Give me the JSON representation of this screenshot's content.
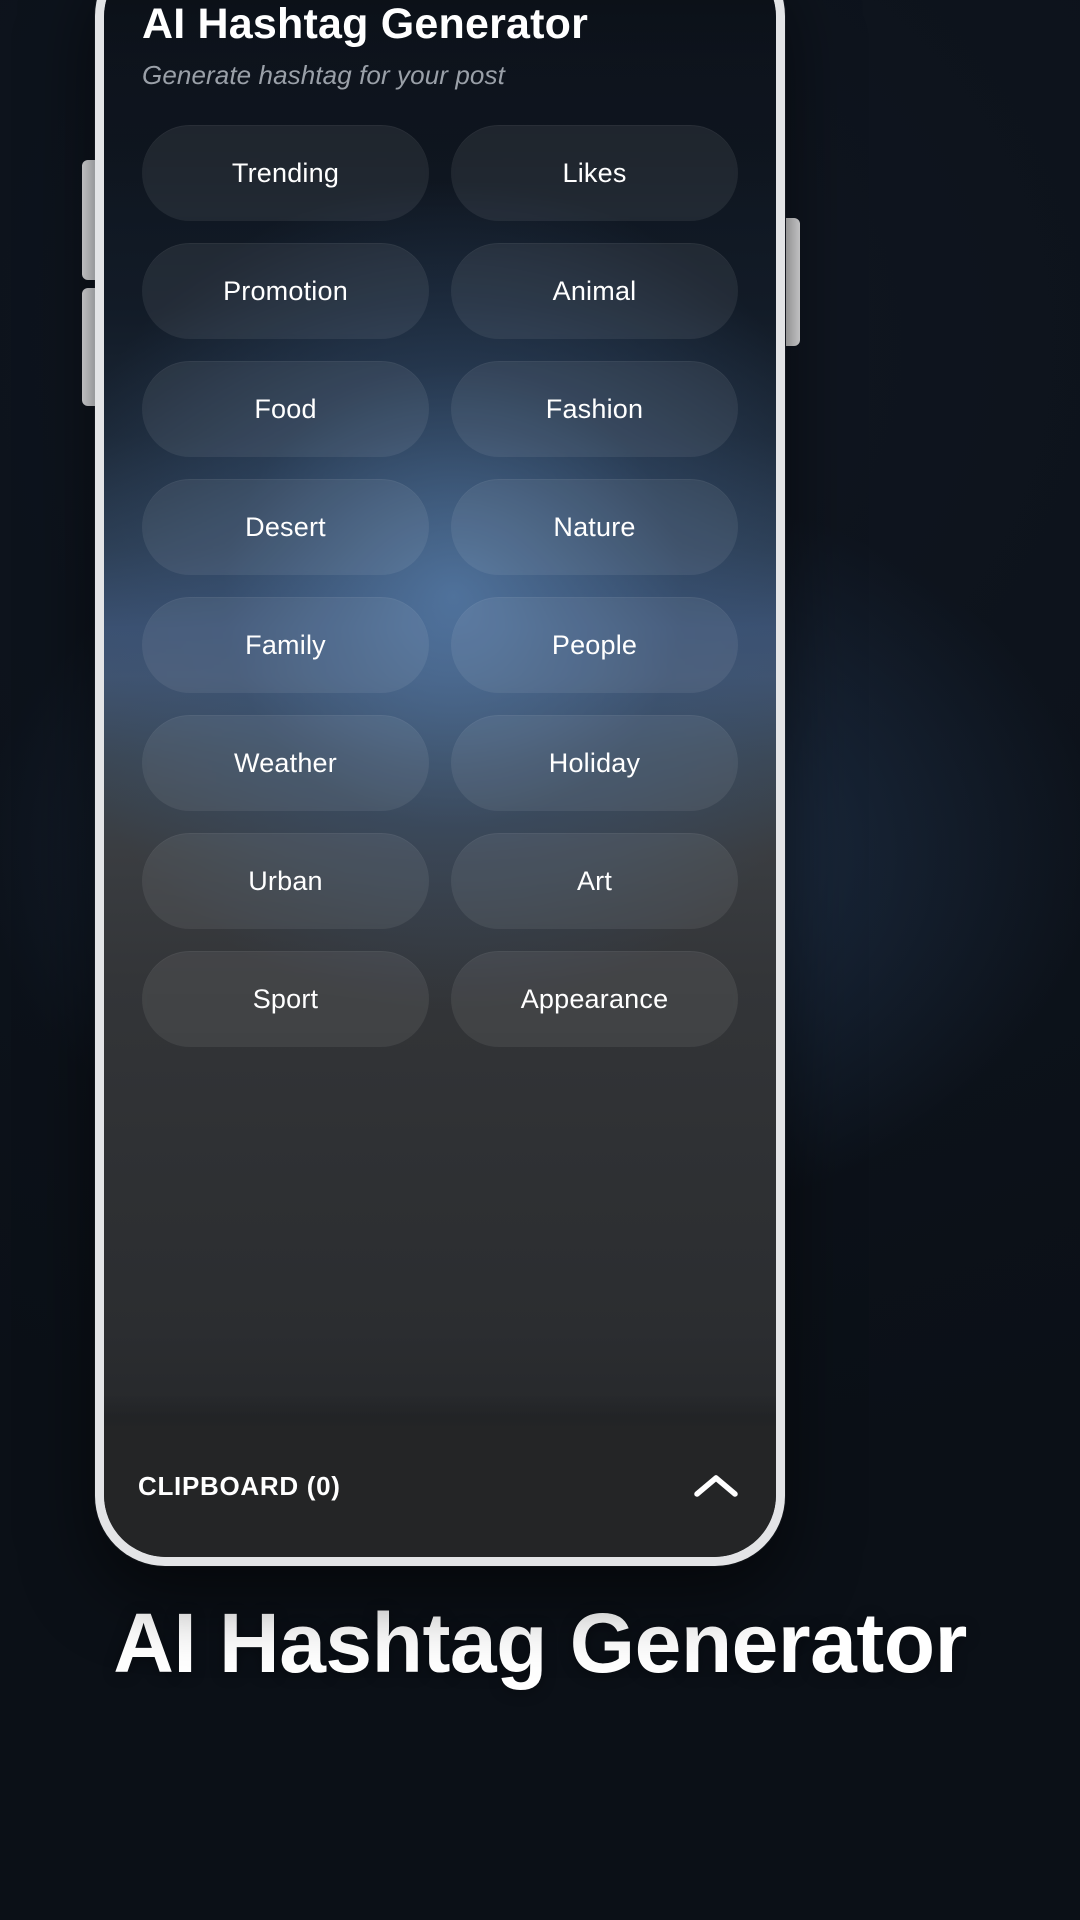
{
  "promo": {
    "caption": "AI Hashtag Generator",
    "background_top_color": "#0c1118",
    "background_mid_color": "#33414f",
    "background_bottom_color": "#2b2e32"
  },
  "phone": {
    "frame_color": "#e3e4e6",
    "buttons": [
      {
        "name": "volume-up",
        "label": "Volume Up"
      },
      {
        "name": "volume-down",
        "label": "Volume Down"
      },
      {
        "name": "power",
        "label": "Power"
      }
    ]
  },
  "app": {
    "title": "AI Hashtag Generator",
    "subtitle": "Generate hashtag for your post",
    "title_color": "#ffffff",
    "subtitle_color": "#9aa0a8",
    "categories": [
      {
        "label": "Trending"
      },
      {
        "label": "Likes"
      },
      {
        "label": "Promotion"
      },
      {
        "label": "Animal"
      },
      {
        "label": "Food"
      },
      {
        "label": "Fashion"
      },
      {
        "label": "Desert"
      },
      {
        "label": "Nature"
      },
      {
        "label": "Family"
      },
      {
        "label": "People"
      },
      {
        "label": "Weather"
      },
      {
        "label": "Holiday"
      },
      {
        "label": "Urban"
      },
      {
        "label": "Art"
      },
      {
        "label": "Sport"
      },
      {
        "label": "Appearance"
      }
    ],
    "clipboard": {
      "label": "CLIPBOARD (0)",
      "count": 0,
      "expand_icon": "chevron-up-icon",
      "bar_color": "#242526"
    }
  }
}
